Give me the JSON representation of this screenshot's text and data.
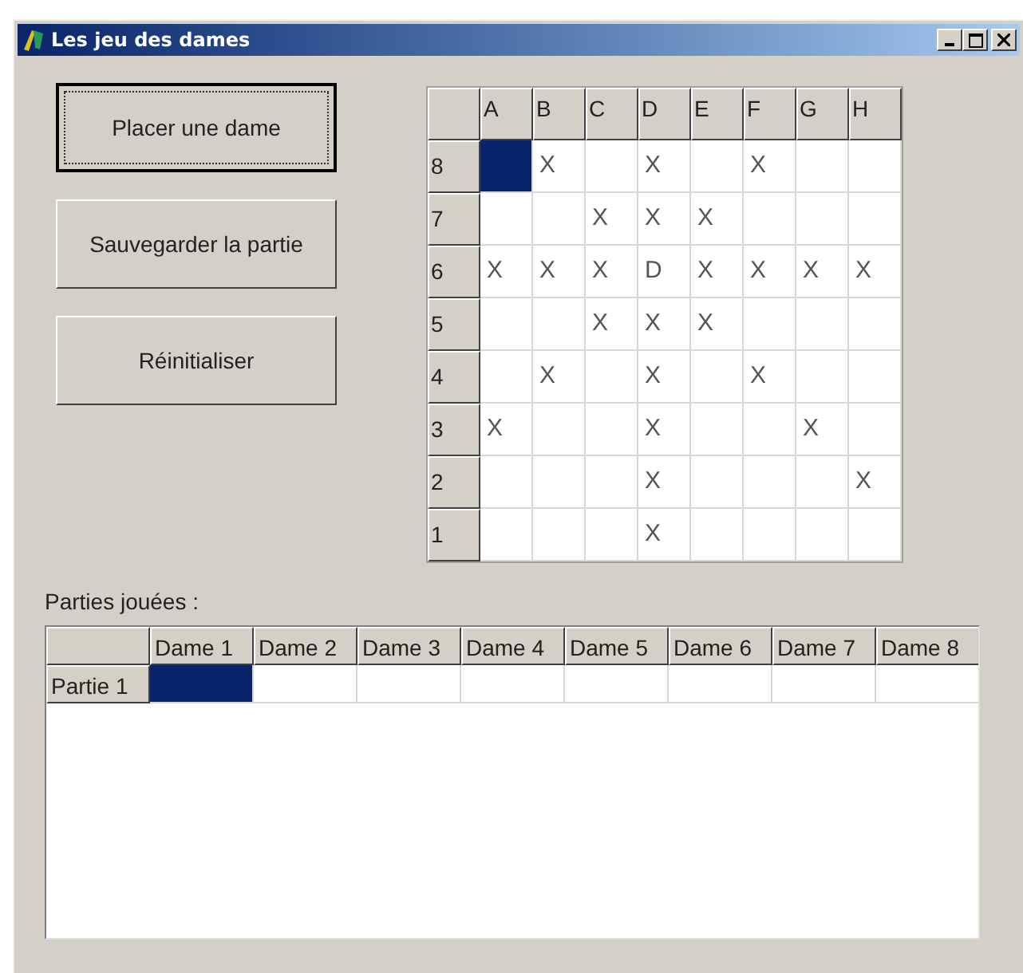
{
  "window": {
    "title": "Les jeu des dames"
  },
  "buttons": [
    {
      "label": "Placer une dame",
      "default": true
    },
    {
      "label": "Sauvegarder la partie",
      "default": false
    },
    {
      "label": "Réinitialiser",
      "default": false
    }
  ],
  "board": {
    "columns": [
      "A",
      "B",
      "C",
      "D",
      "E",
      "F",
      "G",
      "H"
    ],
    "rows": [
      {
        "label": "8",
        "cells": [
          {
            "text": "",
            "selected": true
          },
          {
            "text": "X",
            "selected": false
          },
          {
            "text": "",
            "selected": false
          },
          {
            "text": "X",
            "selected": false
          },
          {
            "text": "",
            "selected": false
          },
          {
            "text": "X",
            "selected": false
          },
          {
            "text": "",
            "selected": false
          },
          {
            "text": "",
            "selected": false
          }
        ]
      },
      {
        "label": "7",
        "cells": [
          {
            "text": "",
            "selected": false
          },
          {
            "text": "",
            "selected": false
          },
          {
            "text": "X",
            "selected": false
          },
          {
            "text": "X",
            "selected": false
          },
          {
            "text": "X",
            "selected": false
          },
          {
            "text": "",
            "selected": false
          },
          {
            "text": "",
            "selected": false
          },
          {
            "text": "",
            "selected": false
          }
        ]
      },
      {
        "label": "6",
        "cells": [
          {
            "text": "X",
            "selected": false
          },
          {
            "text": "X",
            "selected": false
          },
          {
            "text": "X",
            "selected": false
          },
          {
            "text": "D",
            "selected": false
          },
          {
            "text": "X",
            "selected": false
          },
          {
            "text": "X",
            "selected": false
          },
          {
            "text": "X",
            "selected": false
          },
          {
            "text": "X",
            "selected": false
          }
        ]
      },
      {
        "label": "5",
        "cells": [
          {
            "text": "",
            "selected": false
          },
          {
            "text": "",
            "selected": false
          },
          {
            "text": "X",
            "selected": false
          },
          {
            "text": "X",
            "selected": false
          },
          {
            "text": "X",
            "selected": false
          },
          {
            "text": "",
            "selected": false
          },
          {
            "text": "",
            "selected": false
          },
          {
            "text": "",
            "selected": false
          }
        ]
      },
      {
        "label": "4",
        "cells": [
          {
            "text": "",
            "selected": false
          },
          {
            "text": "X",
            "selected": false
          },
          {
            "text": "",
            "selected": false
          },
          {
            "text": "X",
            "selected": false
          },
          {
            "text": "",
            "selected": false
          },
          {
            "text": "X",
            "selected": false
          },
          {
            "text": "",
            "selected": false
          },
          {
            "text": "",
            "selected": false
          }
        ]
      },
      {
        "label": "3",
        "cells": [
          {
            "text": "X",
            "selected": false
          },
          {
            "text": "",
            "selected": false
          },
          {
            "text": "",
            "selected": false
          },
          {
            "text": "X",
            "selected": false
          },
          {
            "text": "",
            "selected": false
          },
          {
            "text": "",
            "selected": false
          },
          {
            "text": "X",
            "selected": false
          },
          {
            "text": "",
            "selected": false
          }
        ]
      },
      {
        "label": "2",
        "cells": [
          {
            "text": "",
            "selected": false
          },
          {
            "text": "",
            "selected": false
          },
          {
            "text": "",
            "selected": false
          },
          {
            "text": "X",
            "selected": false
          },
          {
            "text": "",
            "selected": false
          },
          {
            "text": "",
            "selected": false
          },
          {
            "text": "",
            "selected": false
          },
          {
            "text": "X",
            "selected": false
          }
        ]
      },
      {
        "label": "1",
        "cells": [
          {
            "text": "",
            "selected": false
          },
          {
            "text": "",
            "selected": false
          },
          {
            "text": "",
            "selected": false
          },
          {
            "text": "X",
            "selected": false
          },
          {
            "text": "",
            "selected": false
          },
          {
            "text": "",
            "selected": false
          },
          {
            "text": "",
            "selected": false
          },
          {
            "text": "",
            "selected": false
          }
        ]
      }
    ]
  },
  "games": {
    "label": "Parties jouées :",
    "columns": [
      "Dame 1",
      "Dame 2",
      "Dame 3",
      "Dame 4",
      "Dame 5",
      "Dame 6",
      "Dame 7",
      "Dame 8"
    ],
    "rows": [
      {
        "label": "Partie 1",
        "cells": [
          {
            "text": "",
            "selected": true
          },
          {
            "text": "",
            "selected": false
          },
          {
            "text": "",
            "selected": false
          },
          {
            "text": "",
            "selected": false
          },
          {
            "text": "",
            "selected": false
          },
          {
            "text": "",
            "selected": false
          },
          {
            "text": "",
            "selected": false
          },
          {
            "text": "",
            "selected": false
          }
        ]
      }
    ]
  }
}
